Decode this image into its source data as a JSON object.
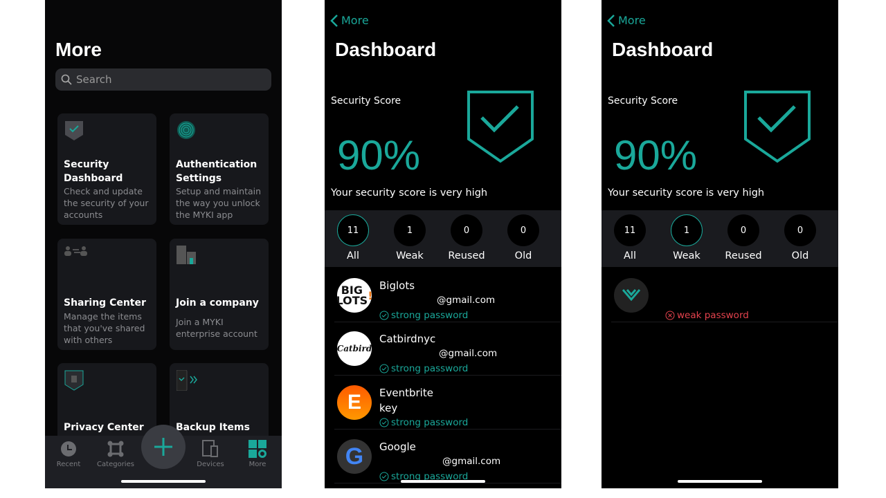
{
  "more": {
    "title": "More",
    "search_placeholder": "Search",
    "cards": [
      {
        "title": "Security Dashboard",
        "desc": "Check and update the security of your accounts",
        "icon": "shield-check-icon"
      },
      {
        "title": "Authentication Settings",
        "desc": "Setup and maintain the way you unlock the MYKI app",
        "icon": "fingerprint-icon"
      },
      {
        "title": "Sharing Center",
        "desc": "Manage the items that you've shared with others",
        "icon": "sharing-users-icon"
      },
      {
        "title": "Join a company",
        "desc": "Join a MYKI enterprise account",
        "icon": "building-icon"
      },
      {
        "title": "Privacy Center",
        "desc": "",
        "icon": "privacy-shield-icon"
      },
      {
        "title": "Backup Items",
        "desc": "",
        "icon": "phone-backup-icon"
      }
    ],
    "tabs": [
      {
        "label": "Recent",
        "icon": "clock-icon"
      },
      {
        "label": "Categories",
        "icon": "categories-icon"
      },
      {
        "label": "Devices",
        "icon": "devices-icon"
      },
      {
        "label": "More",
        "icon": "more-grid-icon",
        "active": true
      }
    ]
  },
  "colors": {
    "accent": "#1aa89a",
    "danger": "#e4424d"
  },
  "dashboard": {
    "back_label": "More",
    "title": "Dashboard",
    "score_label": "Security Score",
    "score": "90%",
    "score_text": "Your security score is very high",
    "filters": [
      {
        "label": "All",
        "count": "11"
      },
      {
        "label": "Weak",
        "count": "1"
      },
      {
        "label": "Reused",
        "count": "0"
      },
      {
        "label": "Old",
        "count": "0"
      }
    ],
    "items": [
      {
        "name": "Biglots",
        "detail": "@gmail.com",
        "status": "strong password"
      },
      {
        "name": "Catbirdnyc",
        "detail": "@gmail.com",
        "status": "strong password"
      },
      {
        "name": "Eventbrite",
        "detail": "key",
        "status": "strong password"
      },
      {
        "name": "Google",
        "detail": "@gmail.com",
        "status": "strong password"
      }
    ],
    "weak_items": [
      {
        "name": "",
        "detail": "",
        "status": "weak password"
      }
    ]
  }
}
